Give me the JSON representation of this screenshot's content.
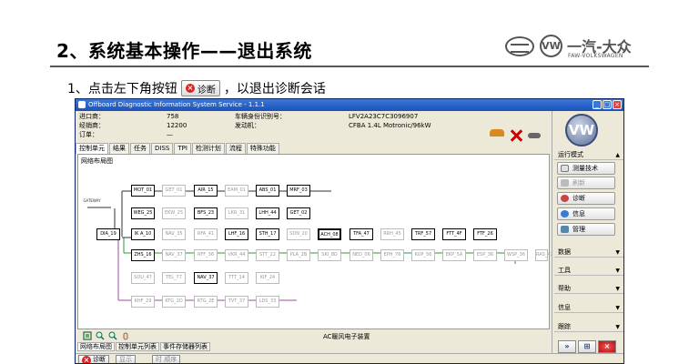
{
  "slide": {
    "title": "2、系统基本操作——退出系统",
    "instruction_prefix": "1、点击左下角按钮",
    "instruction_suffix": "，以退出诊断会话",
    "inline_button_label": "诊断",
    "logo_cn": "一汽-大众",
    "logo_en": "FAW-VOLKSWAGEN"
  },
  "app": {
    "window_title": "Offboard Diagnostic Information System Service - 1.1.1",
    "info": {
      "left": [
        {
          "label": "进口商：",
          "value": "758"
        },
        {
          "label": "经销商：",
          "value": "12200"
        },
        {
          "label": "订单：",
          "value": "—"
        }
      ],
      "right": [
        {
          "label": "车辆身份识别号：",
          "value": "LFV2A23C7C3096907"
        },
        {
          "label": "发动机：",
          "value": "CFBA 1.4L Motronic/96kW"
        }
      ]
    },
    "tabs": [
      "控制单元",
      "结果",
      "任务",
      "DISS",
      "TPI",
      "检测计划",
      "流程",
      "特殊功能"
    ],
    "panel_label": "网络布局图",
    "gateway_label": "GATEWAY",
    "caption": "AC暖风电子装置",
    "bottom_tabs": [
      "网络布局图",
      "控制单元列表",
      "事件存储器列表"
    ],
    "status_buttons": {
      "diagnose": "诊断",
      "display": "显示",
      "sequence": "时 顺序"
    },
    "nodes": [
      {
        "id": "n1",
        "label": "MOT_01",
        "state": "active"
      },
      {
        "id": "n2",
        "label": "GET_01",
        "state": "inactive"
      },
      {
        "id": "n3",
        "label": "AIR_15",
        "state": "active"
      },
      {
        "id": "n4",
        "label": "EAM_01",
        "state": "inactive"
      },
      {
        "id": "n5",
        "label": "ABS_01",
        "state": "active"
      },
      {
        "id": "n6",
        "label": "MRF_03",
        "state": "active"
      },
      {
        "id": "n7",
        "label": "WEG_25",
        "state": "active"
      },
      {
        "id": "n8",
        "label": "EKW_25",
        "state": "inactive"
      },
      {
        "id": "n9",
        "label": "BFS_23",
        "state": "active"
      },
      {
        "id": "n10",
        "label": "LKR_31",
        "state": "inactive"
      },
      {
        "id": "n11",
        "label": "LHH_44",
        "state": "active"
      },
      {
        "id": "n12",
        "label": "GET_02",
        "state": "active"
      },
      {
        "id": "n13",
        "label": "DIA_19",
        "state": "active"
      },
      {
        "id": "n14",
        "label": "IK A_10",
        "state": "active"
      },
      {
        "id": "n15",
        "label": "NAV_35",
        "state": "inactive"
      },
      {
        "id": "n16",
        "label": "RFA_41",
        "state": "inactive"
      },
      {
        "id": "n17",
        "label": "LHF_16",
        "state": "active"
      },
      {
        "id": "n18",
        "label": "STH_17",
        "state": "active"
      },
      {
        "id": "n19",
        "label": "SDN_20",
        "state": "inactive"
      },
      {
        "id": "n20",
        "label": "ACH_08",
        "state": "current"
      },
      {
        "id": "n21",
        "label": "TFA_47",
        "state": "active"
      },
      {
        "id": "n22",
        "label": "RRH_45",
        "state": "inactive"
      },
      {
        "id": "n23",
        "label": "TRF_57",
        "state": "active"
      },
      {
        "id": "n24",
        "label": "FTT_4F",
        "state": "active"
      },
      {
        "id": "n25",
        "label": "FTF_26",
        "state": "active"
      },
      {
        "id": "n26",
        "label": "ZHS_16",
        "state": "active"
      },
      {
        "id": "n27",
        "label": "NAV_37",
        "state": "inactive"
      },
      {
        "id": "n28",
        "label": "RFF_36",
        "state": "inactive"
      },
      {
        "id": "n29",
        "label": "VKR_44",
        "state": "inactive"
      },
      {
        "id": "n30",
        "label": "STT_22",
        "state": "inactive"
      },
      {
        "id": "n31",
        "label": "PLA_2B",
        "state": "inactive"
      },
      {
        "id": "n32",
        "label": "SKI_8D",
        "state": "inactive"
      },
      {
        "id": "n33",
        "label": "NED_06",
        "state": "inactive"
      },
      {
        "id": "n34",
        "label": "EPH_76",
        "state": "inactive"
      },
      {
        "id": "n35",
        "label": "KUP_56",
        "state": "inactive"
      },
      {
        "id": "n36",
        "label": "EKP_5A",
        "state": "inactive"
      },
      {
        "id": "n37",
        "label": "ESP_36",
        "state": "inactive"
      },
      {
        "id": "n38",
        "label": "WSP_36",
        "state": "inactive"
      },
      {
        "id": "n39",
        "label": "RAS_41",
        "state": "inactive"
      },
      {
        "id": "n40",
        "label": "SOU_47",
        "state": "inactive"
      },
      {
        "id": "n41",
        "label": "TEL_77",
        "state": "inactive"
      },
      {
        "id": "n42",
        "label": "NAV_37",
        "state": "active"
      },
      {
        "id": "n43",
        "label": "TTT_14",
        "state": "inactive"
      },
      {
        "id": "n44",
        "label": "KIF_24",
        "state": "inactive"
      },
      {
        "id": "n45",
        "label": "KHF_29",
        "state": "inactive"
      },
      {
        "id": "n46",
        "label": "KTG_2D",
        "state": "inactive"
      },
      {
        "id": "n47",
        "label": "RTG_2E",
        "state": "inactive"
      },
      {
        "id": "n48",
        "label": "TVT_37",
        "state": "inactive"
      },
      {
        "id": "n49",
        "label": "LDS_33",
        "state": "inactive"
      }
    ]
  },
  "right_panel": {
    "badge": "VW",
    "section_mode": "运行模式",
    "mode_buttons": [
      {
        "label": "测量技术",
        "disabled": false,
        "icon": "measure-icon"
      },
      {
        "label": "刷新",
        "disabled": true,
        "icon": "flash-icon"
      },
      {
        "label": "诊断",
        "disabled": false,
        "icon": "diagnose-icon"
      },
      {
        "label": "信息",
        "disabled": false,
        "icon": "info-icon"
      },
      {
        "label": "管理",
        "disabled": false,
        "icon": "admin-icon"
      }
    ],
    "sections": [
      "数据",
      "工具",
      "帮助",
      "信息",
      "跟踪"
    ]
  }
}
